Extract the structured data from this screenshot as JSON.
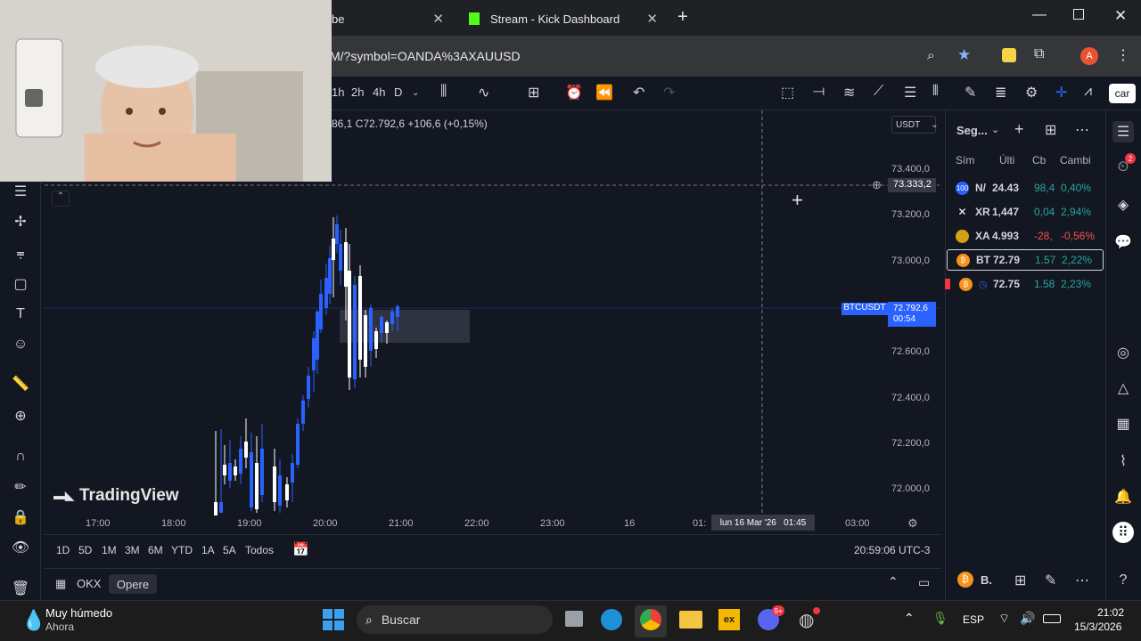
{
  "browser": {
    "tabs": [
      {
        "label": "be"
      },
      {
        "label": "Stream - Kick Dashboard"
      }
    ],
    "url": "M/?symbol=OANDA%3AXAUUSD",
    "profile_initial": "A",
    "new_tab_label": "+"
  },
  "toolbar": {
    "intervals": [
      "1h",
      "2h",
      "4h",
      "D"
    ],
    "right_button_label": "car"
  },
  "legend": {
    "ohlc_text": "86,1  C72.792,6  +106,6 (+0,15%)"
  },
  "chart": {
    "currency_label": "USDT",
    "price_axis": [
      "73.400,0",
      "73.200,0",
      "73.000,0",
      "72.600,0",
      "72.400,0",
      "72.200,0",
      "72.000,0"
    ],
    "crosshair_price": "73.333,2",
    "symbol_tag": "BTCUSDT",
    "last_price": "72.792,6",
    "countdown": "00:54",
    "time_axis": [
      "17:00",
      "18:00",
      "19:00",
      "20:00",
      "21:00",
      "22:00",
      "23:00",
      "16",
      "01:",
      "03:00"
    ],
    "crosshair_time": "lun 16 Mar '26   01:45",
    "watermark": "TradingView"
  },
  "chart_data": {
    "type": "candlestick",
    "title": "",
    "ylim": [
      71950,
      73450
    ],
    "x": [
      "17:00",
      "18:00",
      "19:00",
      "20:00",
      "21:00"
    ],
    "candles_note": "",
    "last": 72792.6
  },
  "range_bar": {
    "ranges": [
      "1D",
      "5D",
      "1M",
      "3M",
      "6M",
      "YTD",
      "1A",
      "5A",
      "Todos"
    ],
    "clock": "20:59:06 UTC-3"
  },
  "footer": {
    "exchange": "OKX",
    "trade_button": "Opere"
  },
  "watchlist": {
    "header": "Seg...",
    "columns": [
      "Sím",
      "Últi",
      "Cb",
      "Cambi"
    ],
    "rows": [
      {
        "sym": "N/",
        "last": "24.43",
        "chg": "98,4",
        "pct": "0,40%",
        "color": "#26a69a",
        "icon": "100"
      },
      {
        "sym": "XR",
        "last": "1,447",
        "chg": "0,04",
        "pct": "2,94%",
        "color": "#26a69a",
        "icon": "✕"
      },
      {
        "sym": "XA",
        "last": "4.993",
        "chg": "-28,",
        "pct": "-0,56%",
        "color": "#ef5350",
        "icon": "gold"
      },
      {
        "sym": "BT",
        "last": "72.79",
        "chg": "1.57",
        "pct": "2,22%",
        "color": "#26a69a",
        "icon": "btc"
      },
      {
        "sym": "",
        "last": "72.75",
        "chg": "1.58",
        "pct": "2,23%",
        "color": "#26a69a",
        "icon": "btc"
      }
    ],
    "bottom_label": "B."
  },
  "taskbar": {
    "weather_title": "Muy húmedo",
    "weather_sub": "Ahora",
    "search_placeholder": "Buscar",
    "lang": "ESP",
    "time": "21:02",
    "date": "15/3/2026",
    "discord_badge": "9+",
    "notif_badge": "2"
  }
}
